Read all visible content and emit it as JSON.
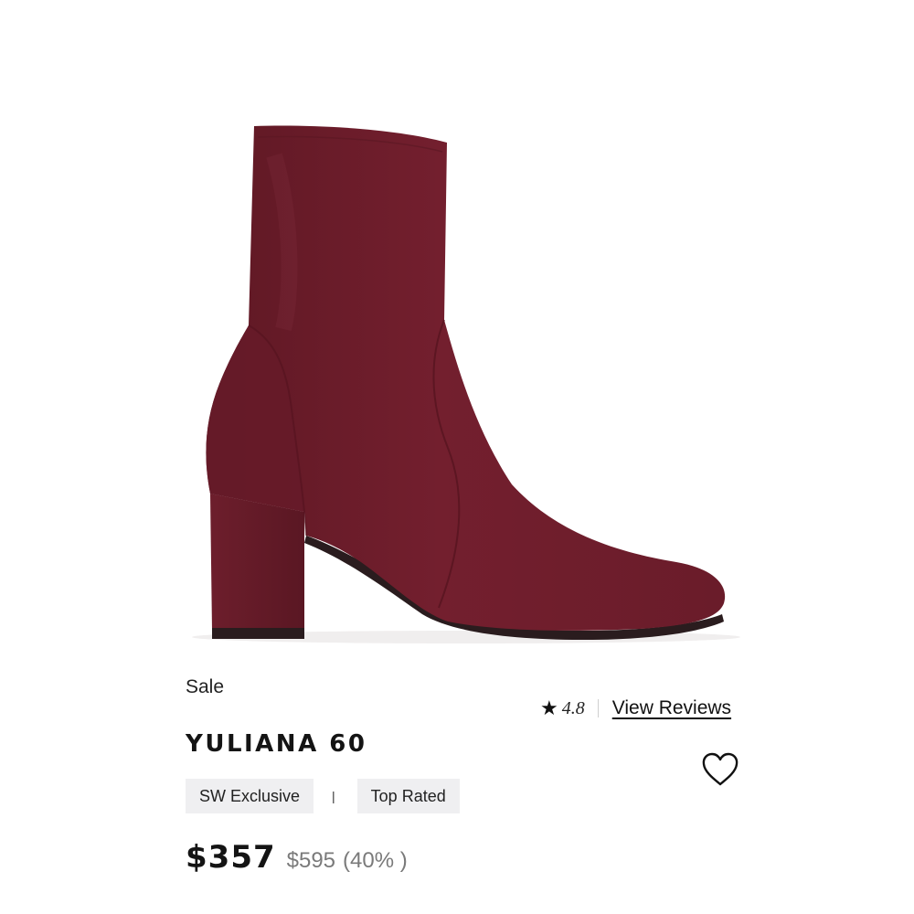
{
  "product": {
    "image_icon": "burgundy-suede-ankle-boot",
    "colors": {
      "boot": "#6e1e2c",
      "sole": "#2a1c1e"
    },
    "sale_label": "Sale",
    "rating": {
      "value": "4.8",
      "icon": "star-icon"
    },
    "view_reviews": "View Reviews",
    "name": "YULIANA 60",
    "badges": [
      "SW Exclusive",
      "Top Rated"
    ],
    "badge_separator": "|",
    "price": {
      "sale": "$357",
      "original": "$595",
      "discount": "(40% )"
    },
    "wishlist_icon": "heart-outline-icon"
  }
}
